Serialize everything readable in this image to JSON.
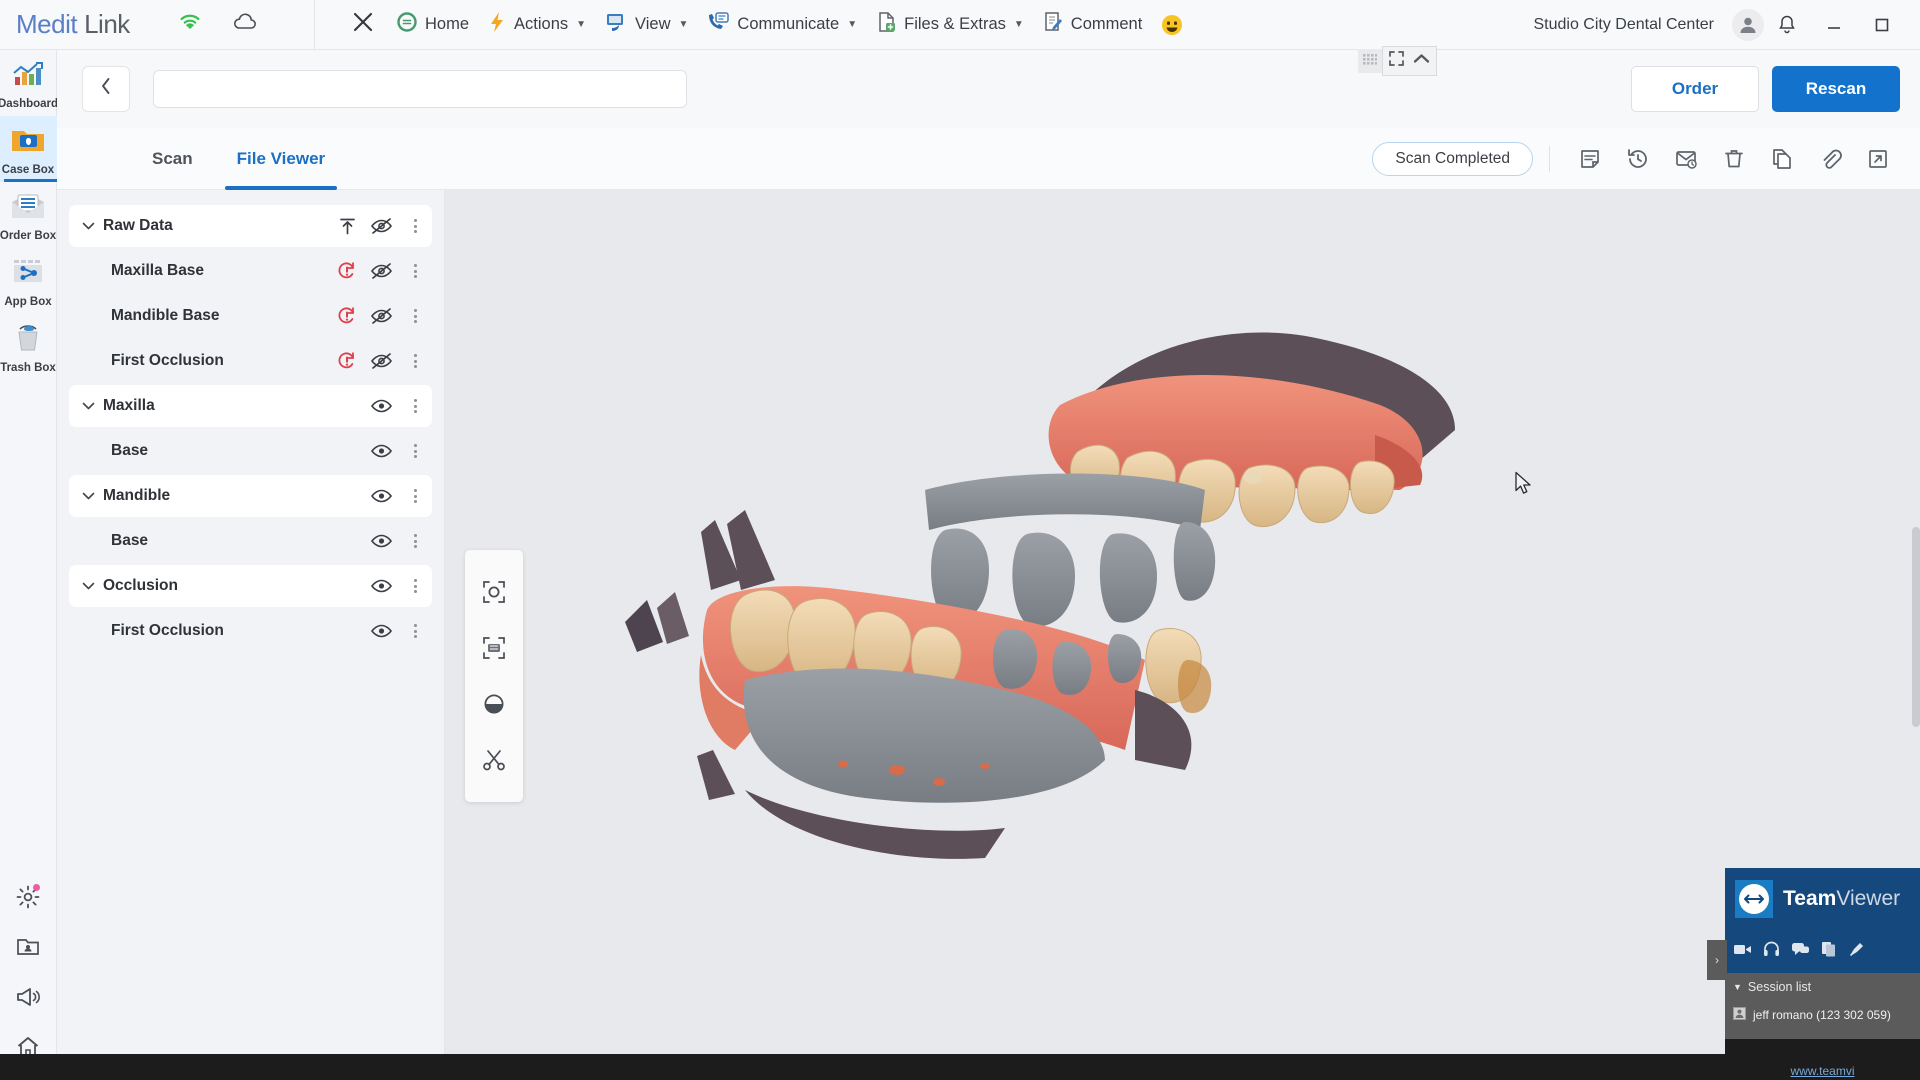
{
  "app": {
    "brand_primary": "Medit",
    "brand_secondary": "Link",
    "accent_color": "#1b6fc4",
    "org_name": "Studio City Dental Center"
  },
  "topbar": {
    "close_label": "close-window",
    "menus": [
      {
        "label": "Home",
        "icon": "home-ring-icon",
        "has_caret": false
      },
      {
        "label": "Actions",
        "icon": "lightning-icon",
        "has_caret": true
      },
      {
        "label": "View",
        "icon": "monitor-icon",
        "has_caret": true
      },
      {
        "label": "Communicate",
        "icon": "chat-phone-icon",
        "has_caret": true
      },
      {
        "label": "Files & Extras",
        "icon": "file-plus-icon",
        "has_caret": true
      },
      {
        "label": "Comment",
        "icon": "note-pen-icon",
        "has_caret": false
      }
    ],
    "emoji": "smiley-icon",
    "status_icons": [
      "wifi-icon",
      "cloud-icon"
    ],
    "window_controls": [
      "minimize-icon",
      "maximize-icon"
    ],
    "notification_icon": "bell-icon",
    "account_icon": "user-avatar"
  },
  "rail": {
    "items": [
      {
        "label": "Dashboard",
        "icon": "chart-icon",
        "active": false
      },
      {
        "label": "Case Box",
        "icon": "case-folder-icon",
        "active": true
      },
      {
        "label": "Order Box",
        "icon": "order-envelope-icon",
        "active": false
      },
      {
        "label": "App Box",
        "icon": "app-share-icon",
        "active": false
      },
      {
        "label": "Trash Box",
        "icon": "trash-bin-icon",
        "active": false
      }
    ],
    "bottom_items": [
      {
        "icon": "gear-icon",
        "badge": true
      },
      {
        "icon": "folder-user-icon",
        "badge": false
      },
      {
        "icon": "megaphone-icon",
        "badge": false
      },
      {
        "icon": "home-icon",
        "badge": false
      }
    ]
  },
  "header": {
    "back_icon": "chevron-left-icon",
    "search_value": "",
    "search_placeholder": "",
    "order_label": "Order",
    "rescan_label": "Rescan",
    "mini_toolbar": [
      "grid-icon",
      "fullscreen-icon",
      "chevron-up-icon"
    ]
  },
  "tabs": [
    {
      "label": "Scan",
      "active": false
    },
    {
      "label": "File Viewer",
      "active": true
    }
  ],
  "status": {
    "badge_label": "Scan Completed",
    "toolbar_icons": [
      "note-icon",
      "history-icon",
      "mail-pending-icon",
      "trash-icon",
      "copy-icon",
      "attachment-icon",
      "open-external-icon"
    ]
  },
  "tree": {
    "rows": [
      {
        "name": "Raw Data",
        "type": "group",
        "expanded": true,
        "actions": [
          "upload-icon",
          "eye-off-icon",
          "kebab-icon"
        ]
      },
      {
        "name": "Maxilla Base",
        "type": "child",
        "expanded": false,
        "actions": [
          "warning-refresh-icon",
          "eye-off-icon",
          "kebab-icon"
        ]
      },
      {
        "name": "Mandible Base",
        "type": "child",
        "expanded": false,
        "actions": [
          "warning-refresh-icon",
          "eye-off-icon",
          "kebab-icon"
        ]
      },
      {
        "name": "First Occlusion",
        "type": "child",
        "expanded": false,
        "actions": [
          "warning-refresh-icon",
          "eye-off-icon",
          "kebab-icon"
        ]
      },
      {
        "name": "Maxilla",
        "type": "group",
        "expanded": true,
        "actions": [
          "eye-icon",
          "kebab-icon"
        ]
      },
      {
        "name": "Base",
        "type": "child",
        "expanded": false,
        "actions": [
          "eye-icon",
          "kebab-icon"
        ]
      },
      {
        "name": "Mandible",
        "type": "group",
        "expanded": true,
        "actions": [
          "eye-icon",
          "kebab-icon"
        ]
      },
      {
        "name": "Base",
        "type": "child",
        "expanded": false,
        "actions": [
          "eye-icon",
          "kebab-icon"
        ]
      },
      {
        "name": "Occlusion",
        "type": "group",
        "expanded": true,
        "actions": [
          "eye-icon",
          "kebab-icon"
        ]
      },
      {
        "name": "First Occlusion",
        "type": "child",
        "expanded": false,
        "actions": [
          "eye-icon",
          "kebab-icon"
        ]
      }
    ]
  },
  "viewport": {
    "palette_tools": [
      "focus-target-icon",
      "fit-model-icon",
      "occlusion-contrast-icon",
      "scissors-icon"
    ],
    "model": "dental-arch-3d-scan",
    "cursor": "arrow-pointer"
  },
  "teamviewer": {
    "title_bold": "Team",
    "title_light": "Viewer",
    "toolbar_icons": [
      "video-icon",
      "headset-icon",
      "chat-icon",
      "files-icon",
      "whiteboard-icon"
    ],
    "session_list_label": "Session list",
    "sessions": [
      {
        "name": "jeff romano (123 302 059)"
      }
    ],
    "footer_url": "www.teamvi",
    "logo_icon": "teamviewer-arrows-icon",
    "expand_icon": "chevron-right-icon"
  }
}
